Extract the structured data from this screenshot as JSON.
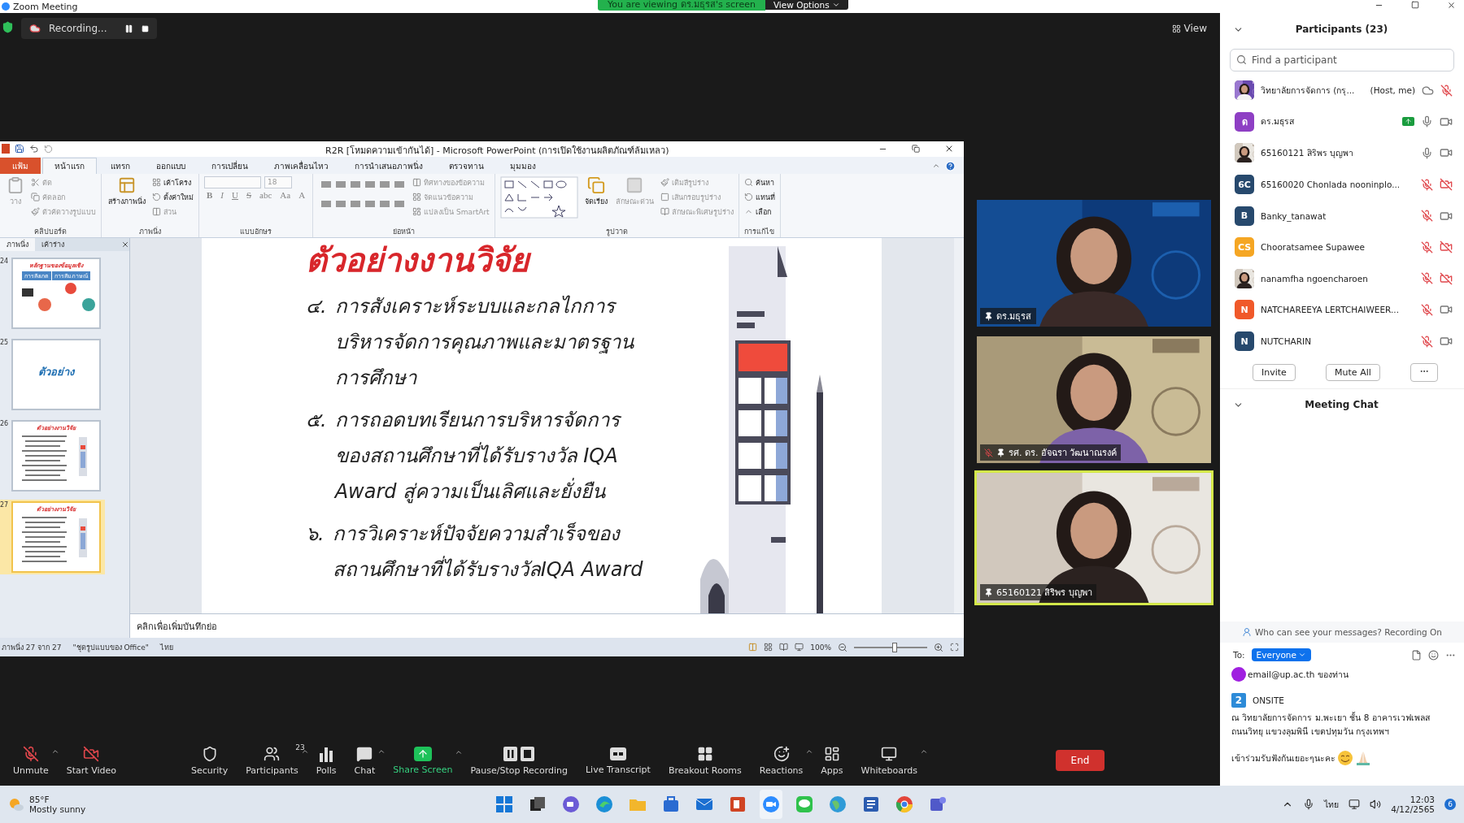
{
  "window": {
    "title": "Zoom Meeting",
    "banner": "You are viewing ดร.มธุรส's screen",
    "view_options": "View Options"
  },
  "recording": {
    "label": "Recording..."
  },
  "view_button": "View",
  "powerpoint": {
    "title": "R2R [โหมดความเข้ากันได้] - Microsoft PowerPoint (การเปิดใช้งานผลิตภัณฑ์ล้มเหลว)",
    "tabs": [
      {
        "label": "แฟ้ม",
        "kind": "file",
        "selected": false
      },
      {
        "label": "หน้าแรก",
        "kind": "tab",
        "selected": true
      },
      {
        "label": "แทรก",
        "kind": "tab",
        "selected": false
      },
      {
        "label": "ออกแบบ",
        "kind": "tab",
        "selected": false
      },
      {
        "label": "การเปลี่ยน",
        "kind": "tab",
        "selected": false
      },
      {
        "label": "ภาพเคลื่อนไหว",
        "kind": "tab",
        "selected": false
      },
      {
        "label": "การนำเสนอภาพนิ่ง",
        "kind": "tab",
        "selected": false
      },
      {
        "label": "ตรวจทาน",
        "kind": "tab",
        "selected": false
      },
      {
        "label": "มุมมอง",
        "kind": "tab",
        "selected": false
      }
    ],
    "groups": [
      {
        "kind": "clipboard",
        "label": "คลิปบอร์ด",
        "large": [
          {
            "label": "วาง",
            "disabled": true
          }
        ],
        "small": [
          {
            "label": "ตัด",
            "disabled": true
          },
          {
            "label": "คัดลอก",
            "disabled": true
          },
          {
            "label": "ตัวคัดวางรูปแบบ",
            "disabled": true
          }
        ]
      },
      {
        "kind": "slides",
        "label": "ภาพนิ่ง",
        "large": [
          {
            "label": "สร้างภาพนิ่ง",
            "disabled": false
          }
        ],
        "small": [
          {
            "label": "เค้าโครง",
            "disabled": false
          },
          {
            "label": "ตั้งค่าใหม่",
            "disabled": false
          },
          {
            "label": "ส่วน",
            "disabled": true
          }
        ]
      },
      {
        "kind": "font",
        "label": "แบบอักษร",
        "font_size": "18",
        "buttons": [
          "B",
          "I",
          "U",
          "S",
          "abc",
          "Aa",
          "A"
        ]
      },
      {
        "kind": "paragraph",
        "label": "ย่อหน้า",
        "small": [
          {
            "label": "ทิศทางของข้อความ",
            "disabled": true
          },
          {
            "label": "จัดแนวข้อความ",
            "disabled": true
          },
          {
            "label": "แปลงเป็น SmartArt",
            "disabled": true
          }
        ]
      },
      {
        "kind": "drawing",
        "label": "รูปวาด",
        "large": [
          {
            "label": "จัดเรียง",
            "disabled": false
          },
          {
            "label": "ลักษณะด่วน",
            "disabled": true
          }
        ],
        "small": [
          {
            "label": "เติมสีรูปร่าง",
            "disabled": true
          },
          {
            "label": "เส้นกรอบรูปร่าง",
            "disabled": true
          },
          {
            "label": "ลักษณะพิเศษรูปร่าง",
            "disabled": true
          }
        ]
      },
      {
        "kind": "editing",
        "label": "การแก้ไข",
        "small": [
          {
            "label": "ค้นหา",
            "disabled": false
          },
          {
            "label": "แทนที่",
            "disabled": false
          },
          {
            "label": "เลือก",
            "disabled": false
          }
        ]
      }
    ],
    "pane_tabs": [
      {
        "label": "ภาพนิ่ง",
        "selected": true
      },
      {
        "label": "เค้าร่าง",
        "selected": false
      }
    ],
    "slides": [
      {
        "number": "24",
        "kind": "icons",
        "title": "หลักฐานของข้อมูลเชิง",
        "labels": [
          "การสังเกต",
          "การสัมภาษณ์"
        ],
        "selected": false
      },
      {
        "number": "25",
        "kind": "title",
        "title": "ตัวอย่าง",
        "selected": false
      },
      {
        "number": "26",
        "kind": "list",
        "title": "ตัวอย่างงานวิจัย",
        "selected": false
      },
      {
        "number": "27",
        "kind": "list",
        "title": "ตัวอย่างงานวิจัย",
        "selected": true
      }
    ],
    "slide": {
      "title": "ตัวอย่างงานวิจัย",
      "items": [
        {
          "number": "๔.",
          "lines": [
            "การสังเคราะห์ระบบและกลไกการ",
            "บริหารจัดการคุณภาพและมาตรฐาน",
            "การศึกษา"
          ]
        },
        {
          "number": "๕.",
          "lines": [
            "การถอดบทเรียนการบริหารจัดการ",
            "ของสถานศึกษาที่ได้รับรางวัล IQA",
            "Award สู่ความเป็นเลิศและยั่งยืน"
          ]
        },
        {
          "number": "๖.",
          "lines": [
            "การวิเคราะห์ปัจจัยความสำเร็จของ",
            "สถานศึกษาที่ได้รับรางวัลIQA Award"
          ]
        }
      ]
    },
    "notes_placeholder": "คลิกเพื่อเพิ่มบันทึกย่อ",
    "status": {
      "slide": "ภาพนิ่ง 27 จาก 27",
      "theme": "\"ชุดรูปแบบของ Office\"",
      "language": "ไทย",
      "zoom": "100%",
      "zoom_slider": {
        "level": 0.55
      }
    }
  },
  "videos": [
    {
      "name": "ดร.มธุรส",
      "muted": false,
      "active_speaker": false
    },
    {
      "name": "รศ. ดร. อัจฉรา วัฒนาณรงค์",
      "muted": true,
      "active_speaker": false
    },
    {
      "name": "65160121 สิริพร บุญพา",
      "muted": false,
      "active_speaker": true
    }
  ],
  "participants": {
    "title": "Participants (23)",
    "search_placeholder": "Find a participant",
    "items": [
      {
        "name": "วิทยาลัยการจัดการ (กรุ...",
        "suffix": "(Host, me)",
        "recording": true,
        "sharing": false,
        "muted": true
      },
      {
        "name": "ดร.มธุรส",
        "avatar": {
          "kind": "initials",
          "text": "ด",
          "color": "#8e3fc4"
        },
        "recording": false,
        "sharing": true,
        "muted": false,
        "video_off": false
      },
      {
        "name": "65160121 สิริพร  บุญพา",
        "recording": false,
        "sharing": false,
        "muted": false,
        "video_off": false
      },
      {
        "name": "65160020 Chonlada nooninplo...",
        "avatar": {
          "kind": "initials",
          "text": "6C",
          "color": "#27496d"
        },
        "recording": false,
        "sharing": false,
        "muted": true,
        "video_off": true
      },
      {
        "name": "Banky_tanawat",
        "avatar": {
          "kind": "initials",
          "text": "B",
          "color": "#27496d"
        },
        "recording": false,
        "sharing": false,
        "muted": true,
        "video_off": false
      },
      {
        "name": "Chooratsamee Supawee",
        "avatar": {
          "kind": "initials",
          "text": "CS",
          "color": "#f5a623"
        },
        "recording": false,
        "sharing": false,
        "muted": true,
        "video_off": true
      },
      {
        "name": "nanamfha ngoencharoen",
        "recording": false,
        "sharing": false,
        "muted": true,
        "video_off": true
      },
      {
        "name": "NATCHAREEYA LERTCHAIWEER...",
        "avatar": {
          "kind": "initials",
          "text": "N",
          "color": "#f0592a"
        },
        "recording": false,
        "sharing": false,
        "muted": true,
        "video_off": false
      },
      {
        "name": "NUTCHARIN",
        "avatar": {
          "kind": "initials",
          "text": "N",
          "color": "#27496d"
        },
        "recording": false,
        "sharing": false,
        "muted": true,
        "video_off": false
      }
    ],
    "buttons": [
      "Invite",
      "Mute All"
    ]
  },
  "chat": {
    "title": "Meeting Chat",
    "notice": "Who can see your messages? Recording On",
    "to_label": "To:",
    "recipient": "Everyone",
    "messages": [
      {
        "kind": "dot",
        "text": "email@up.ac.th ของท่าน"
      },
      {
        "kind": "numbered",
        "badge": "2",
        "text": "ONSITE"
      },
      {
        "kind": "text",
        "text": "ณ วิทยาลัยการจัดการ ม.พะเยา ชั้น 8 อาคารเวฟเพลส ถนนวิทยุ แขวงลุมพินี เขตปทุมวัน กรุงเทพฯ"
      },
      {
        "kind": "emoji",
        "text": "เข้าร่วมรับฟังกันเยอะๆนะคะ"
      }
    ]
  },
  "toolbar": {
    "items": [
      {
        "kind": "mic",
        "label": "Unmute",
        "off": true,
        "menu": true
      },
      {
        "kind": "video",
        "label": "Start Video",
        "off": true,
        "menu": false
      },
      {
        "kind": "security",
        "label": "Security",
        "menu": false
      },
      {
        "kind": "participants",
        "label": "Participants",
        "count": "23",
        "menu": true
      },
      {
        "kind": "polls",
        "label": "Polls",
        "menu": false
      },
      {
        "kind": "chat",
        "label": "Chat",
        "menu": true
      },
      {
        "kind": "share",
        "label": "Share Screen",
        "menu": true
      },
      {
        "kind": "record",
        "label": "Pause/Stop Recording",
        "menu": false
      },
      {
        "kind": "transcript",
        "label": "Live Transcript",
        "menu": false
      },
      {
        "kind": "breakout",
        "label": "Breakout Rooms",
        "menu": false
      },
      {
        "kind": "reactions",
        "label": "Reactions",
        "menu": true
      },
      {
        "kind": "apps",
        "label": "Apps",
        "menu": false
      },
      {
        "kind": "whiteboard",
        "label": "Whiteboards",
        "menu": true
      }
    ],
    "end": "End"
  },
  "taskbar": {
    "weather": {
      "temp": "85°F",
      "condition": "Mostly sunny"
    },
    "apps": [
      {
        "kind": "start",
        "active": false
      },
      {
        "kind": "taskview",
        "active": false
      },
      {
        "kind": "meet",
        "active": false
      },
      {
        "kind": "edge",
        "active": false
      },
      {
        "kind": "folder",
        "active": false
      },
      {
        "kind": "store",
        "active": false
      },
      {
        "kind": "mail",
        "active": false
      },
      {
        "kind": "powerpoint",
        "active": false
      },
      {
        "kind": "zoom",
        "active": true
      },
      {
        "kind": "line",
        "active": false
      },
      {
        "kind": "maps",
        "active": false
      },
      {
        "kind": "word",
        "active": false
      },
      {
        "kind": "chrome",
        "active": false
      },
      {
        "kind": "teams",
        "active": false
      }
    ],
    "tray": {
      "language": "ไทย",
      "time": "12:03",
      "date": "4/12/2565",
      "notifications": "6"
    }
  }
}
